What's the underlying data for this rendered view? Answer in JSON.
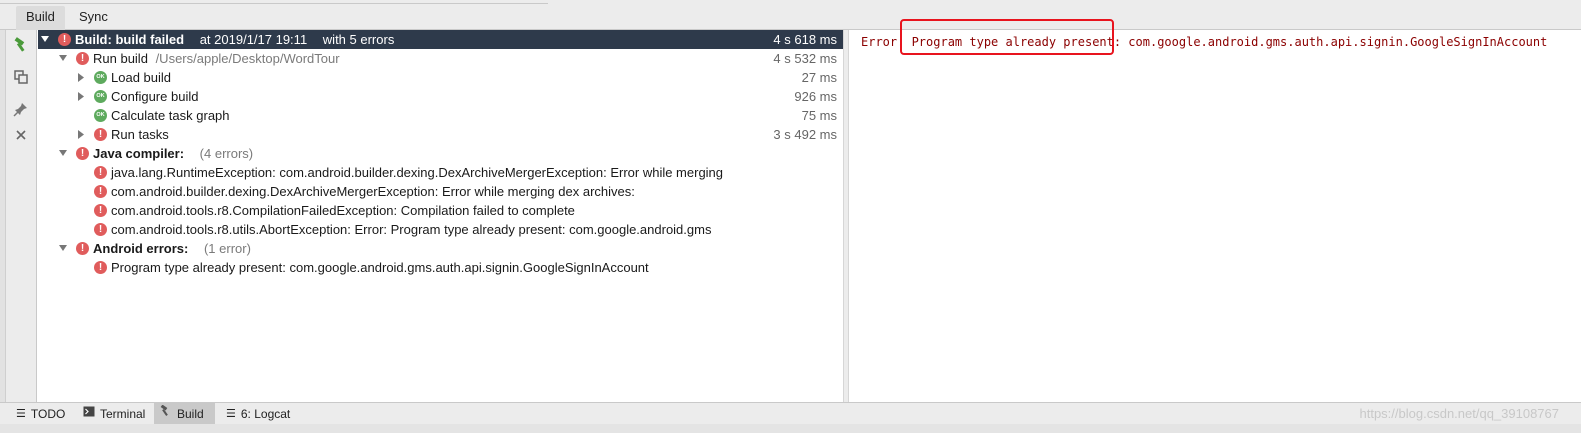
{
  "tabs": [
    {
      "label": "Build",
      "active": true
    },
    {
      "label": "Sync",
      "active": false
    }
  ],
  "tree": {
    "root": {
      "label": "Build:",
      "status_text": "build failed",
      "when": "at 2019/1/17 19:11",
      "errors": "with 5 errors",
      "time": "4 s 618 ms"
    },
    "run_build": {
      "label": "Run build",
      "path": "/Users/apple/Desktop/WordTour",
      "time": "4 s 532 ms"
    },
    "load_build": {
      "label": "Load build",
      "time": "27 ms"
    },
    "configure_build": {
      "label": "Configure build",
      "time": "926 ms"
    },
    "calc_graph": {
      "label": "Calculate task graph",
      "time": "75 ms"
    },
    "run_tasks": {
      "label": "Run tasks",
      "time": "3 s 492 ms"
    },
    "java_compiler": {
      "label": "Java compiler:",
      "count": "(4 errors)"
    },
    "java_errors": [
      "java.lang.RuntimeException: com.android.builder.dexing.DexArchiveMergerException: Error while merging",
      "com.android.builder.dexing.DexArchiveMergerException: Error while merging dex archives:",
      "com.android.tools.r8.CompilationFailedException: Compilation failed to complete",
      "com.android.tools.r8.utils.AbortException: Error: Program type already present: com.google.android.gms"
    ],
    "android_errors": {
      "label": "Android errors:",
      "count": "(1 error)"
    },
    "android_error_items": [
      "Program type already present: com.google.android.gms.auth.api.signin.GoogleSignInAccount"
    ]
  },
  "console": {
    "text": "Error: Program type already present: com.google.android.gms.auth.api.signin.GoogleSignInAccount"
  },
  "bottom_tabs": [
    {
      "label": "TODO",
      "icon": "list-icon",
      "active": false
    },
    {
      "label": "Terminal",
      "icon": "terminal-icon",
      "active": false
    },
    {
      "label": "Build",
      "icon": "hammer-icon",
      "active": true
    },
    {
      "label": "6: Logcat",
      "icon": "logcat-icon",
      "active": false
    }
  ],
  "watermark": "https://blog.csdn.net/qq_39108767",
  "colors": {
    "error": "#e05c5c",
    "ok": "#5eaa5e",
    "selection": "#2e3a4b",
    "highlight_box": "#e8141e",
    "console_text": "#8b0000"
  }
}
